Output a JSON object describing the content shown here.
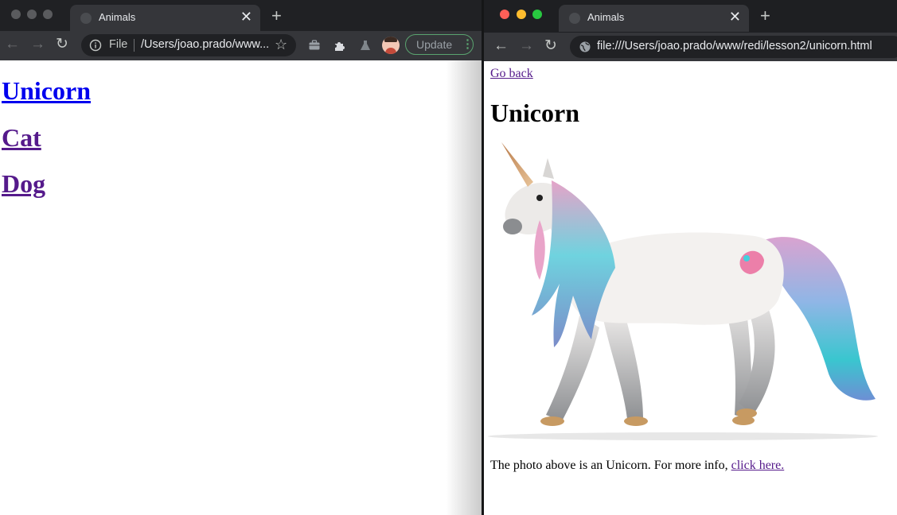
{
  "left_window": {
    "tab": {
      "title": "Animals"
    },
    "toolbar": {
      "scheme_label": "File",
      "address": "/Users/joao.prado/www...",
      "update_label": "Update"
    },
    "page": {
      "links": [
        "Unicorn",
        "Cat",
        "Dog"
      ]
    }
  },
  "right_window": {
    "tab": {
      "title": "Animals"
    },
    "toolbar": {
      "address": "file:///Users/joao.prado/www/redi/lesson2/unicorn.html"
    },
    "page": {
      "back_link": "Go back",
      "heading": "Unicorn",
      "caption": "The photo above is an Unicorn. For more info, ",
      "more_link": "click here."
    }
  },
  "colors": {
    "link_unvisited": "#0000ee",
    "link_visited": "#551a8b",
    "update_border": "#5aa36f"
  }
}
